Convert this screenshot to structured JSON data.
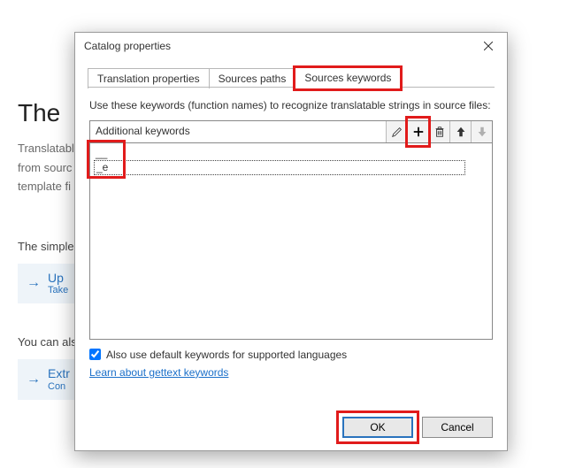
{
  "background": {
    "heading": "The",
    "sub1": "Translatabl",
    "sub2": "from sourc",
    "sub3": "template fi",
    "simple_text": "The simple",
    "update_btn_main": "Up",
    "update_btn_sub": "Take",
    "also_text": "You can als",
    "extract_btn_main": "Extr",
    "extract_btn_sub": "Con"
  },
  "dialog": {
    "title": "Catalog properties",
    "tabs": {
      "t1": "Translation properties",
      "t2": "Sources paths",
      "t3": "Sources keywords"
    },
    "instruction": "Use these keywords (function names) to recognize translatable strings in source files:",
    "kw_label": "Additional keywords",
    "keywords": {
      "k0": "__",
      "k1": "_e"
    },
    "icons": {
      "edit": "edit-icon",
      "add": "add-icon",
      "delete": "delete-icon",
      "up": "up-icon",
      "down": "down-icon"
    },
    "checkbox_label": "Also use default keywords for supported languages",
    "checkbox_checked": true,
    "link_text": "Learn about gettext keywords",
    "buttons": {
      "ok": "OK",
      "cancel": "Cancel"
    }
  }
}
